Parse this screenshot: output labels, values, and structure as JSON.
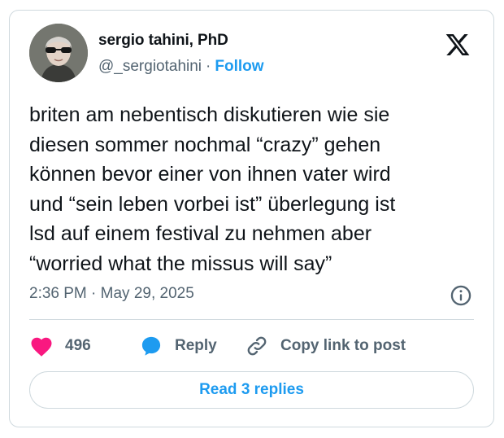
{
  "author": {
    "display_name": "sergio tahini, PhD",
    "handle": "@_sergiotahini",
    "separator": "·",
    "follow_label": "Follow"
  },
  "tweet": {
    "text": "briten am nebentisch diskutieren wie sie\ndiesen sommer nochmal “crazy” gehen\nkönnen bevor einer von ihnen vater wird\nund “sein leben vorbei ist” überlegung ist\nlsd auf einem festival zu nehmen aber\n“worried what the missus will say”",
    "timestamp": "2:36 PM · May 29, 2025"
  },
  "actions": {
    "like_count": "496",
    "reply_label": "Reply",
    "copy_link_label": "Copy link to post"
  },
  "footer": {
    "read_replies_label": "Read 3 replies"
  },
  "icons": {
    "brand": "x-logo-icon",
    "info": "info-icon",
    "like": "heart-icon",
    "reply": "speech-bubble-icon",
    "copy_link": "link-icon"
  },
  "colors": {
    "accent": "#1d9bf0",
    "like": "#f91880",
    "text": "#0f1419",
    "secondary_text": "#536471",
    "border": "#cfd9de"
  }
}
